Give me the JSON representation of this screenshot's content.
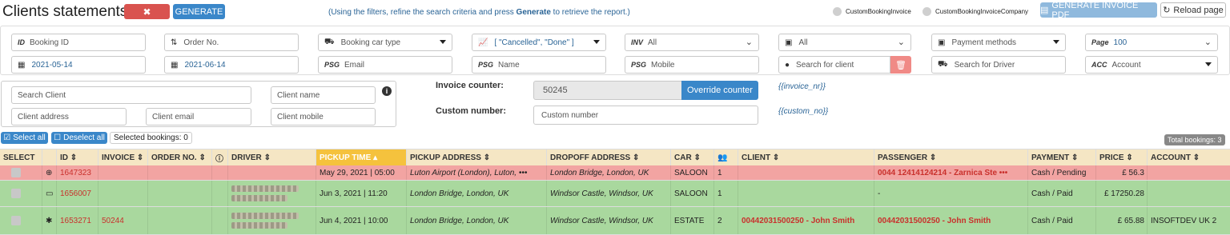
{
  "header": {
    "title": "Clients statements",
    "generate_label": "GENERATE",
    "hint": "(Using the filters, refine the search criteria and press Generate to retrieve the report.)",
    "hint_prefix": "(Using the filters, refine the search criteria and press ",
    "hint_bold": "Generate",
    "hint_suffix": " to retrieve the report.)",
    "radio1": "CustomBookingInvoice",
    "radio2": "CustomBookingInvoiceCompany",
    "pdf_label": "GENERATE INVOICE PDF",
    "reload_label": "Reload page"
  },
  "filters": {
    "booking_id": {
      "prefix": "ID",
      "placeholder": "Booking ID"
    },
    "order_no": {
      "placeholder": "Order No."
    },
    "car_type": {
      "placeholder": "Booking car type"
    },
    "status": {
      "value": "[ \"Cancelled\", \"Done\" ]"
    },
    "inv": {
      "prefix": "INV",
      "value": "All"
    },
    "cash": {
      "value": "All"
    },
    "payment": {
      "placeholder": "Payment methods"
    },
    "page": {
      "prefix": "Page",
      "value": "100"
    },
    "date_from": "2021-05-14",
    "date_to": "2021-06-14",
    "email": {
      "prefix": "PSG",
      "placeholder": "Email"
    },
    "name": {
      "prefix": "PSG",
      "placeholder": "Name"
    },
    "mobile": {
      "prefix": "PSG",
      "placeholder": "Mobile"
    },
    "client": {
      "placeholder": "Search for client"
    },
    "driver": {
      "placeholder": "Search for Driver"
    },
    "account": {
      "prefix": "ACC",
      "placeholder": "Account"
    }
  },
  "client_panel": {
    "search_client": "Search Client",
    "client_name": "Client name",
    "client_address": "Client address",
    "client_email": "Client email",
    "client_mobile": "Client mobile"
  },
  "invoice": {
    "counter_label": "Invoice counter:",
    "counter_value": "50245",
    "override_label": "Override counter",
    "counter_tpl": "{{invoice_nr}}",
    "custom_label": "Custom number:",
    "custom_placeholder": "Custom number",
    "custom_tpl": "{{custom_no}}"
  },
  "selection": {
    "select_all": "Select all",
    "deselect_all": "Deselect all",
    "selected_count": "Selected bookings: 0",
    "total": "Total bookings: 3"
  },
  "table": {
    "columns": [
      "SELECT",
      "ID",
      "INVOICE",
      "ORDER NO.",
      "",
      "DRIVER",
      "PICKUP TIME",
      "PICKUP ADDRESS",
      "DROPOFF ADDRESS",
      "CAR",
      "",
      "CLIENT",
      "PASSENGER",
      "PAYMENT",
      "PRICE",
      "ACCOUNT"
    ],
    "rows": [
      {
        "id": "1647323",
        "invoice": "",
        "pickup_time": "May 29, 2021 | 05:00",
        "pickup": "Luton Airport (London), Luton, •••",
        "dropoff": "London Bridge, London, UK",
        "car": "SALOON",
        "pax": "1",
        "client": "",
        "passenger": "0044 12414124214 - Zarnica Ste •••",
        "payment": "Cash / Pending",
        "price": "£ 56.3",
        "account": ""
      },
      {
        "id": "1656007",
        "invoice": "",
        "pickup_time": "Jun 3, 2021 | 11:20",
        "pickup": "London Bridge, London, UK",
        "dropoff": "Windsor Castle, Windsor, UK",
        "car": "SALOON",
        "pax": "1",
        "client": "",
        "passenger": "-",
        "payment": "Cash / Paid",
        "price": "£ 17250.28",
        "account": ""
      },
      {
        "id": "1653271",
        "invoice": "50244",
        "pickup_time": "Jun 4, 2021 | 10:00",
        "pickup": "London Bridge, London, UK",
        "dropoff": "Windsor Castle, Windsor, UK",
        "car": "ESTATE",
        "pax": "2",
        "client": "00442031500250 - John Smith",
        "passenger": "00442031500250 - John Smith",
        "payment": "Cash / Paid",
        "price": "£ 65.88",
        "account": "INSOFTDEV UK 2"
      }
    ]
  },
  "colors": {
    "red": "#d9534f",
    "blue": "#3a87c9",
    "pink_row": "#f2a4a2",
    "green_row": "#a9d89e",
    "sorted_header": "#f5c23d"
  }
}
